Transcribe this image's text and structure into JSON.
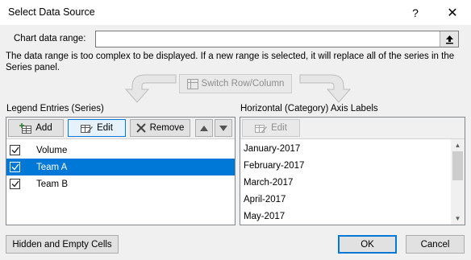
{
  "window": {
    "title": "Select Data Source",
    "help_label": "?",
    "close_label": "✕"
  },
  "range": {
    "label": "Chart data range:",
    "value": ""
  },
  "note": "The data range is too complex to be displayed. If a new range is selected, it will replace all of the series in the Series panel.",
  "switch_label": "Switch Row/Column",
  "legend": {
    "label": "Legend Entries (Series)",
    "add_label": "Add",
    "edit_label": "Edit",
    "remove_label": "Remove",
    "series": [
      {
        "name": "Volume",
        "checked": true,
        "selected": false
      },
      {
        "name": "Team A",
        "checked": true,
        "selected": true
      },
      {
        "name": "Team B",
        "checked": true,
        "selected": false
      }
    ]
  },
  "axis": {
    "label": "Horizontal (Category) Axis Labels",
    "edit_label": "Edit",
    "items": [
      "January-2017",
      "February-2017",
      "March-2017",
      "April-2017",
      "May-2017"
    ]
  },
  "buttons": {
    "hidden_empty": "Hidden and Empty Cells",
    "ok": "OK",
    "cancel": "Cancel"
  },
  "colors": {
    "accent": "#0078d7",
    "selection": "#0078d7",
    "disabled_text": "#8d8d8d"
  }
}
